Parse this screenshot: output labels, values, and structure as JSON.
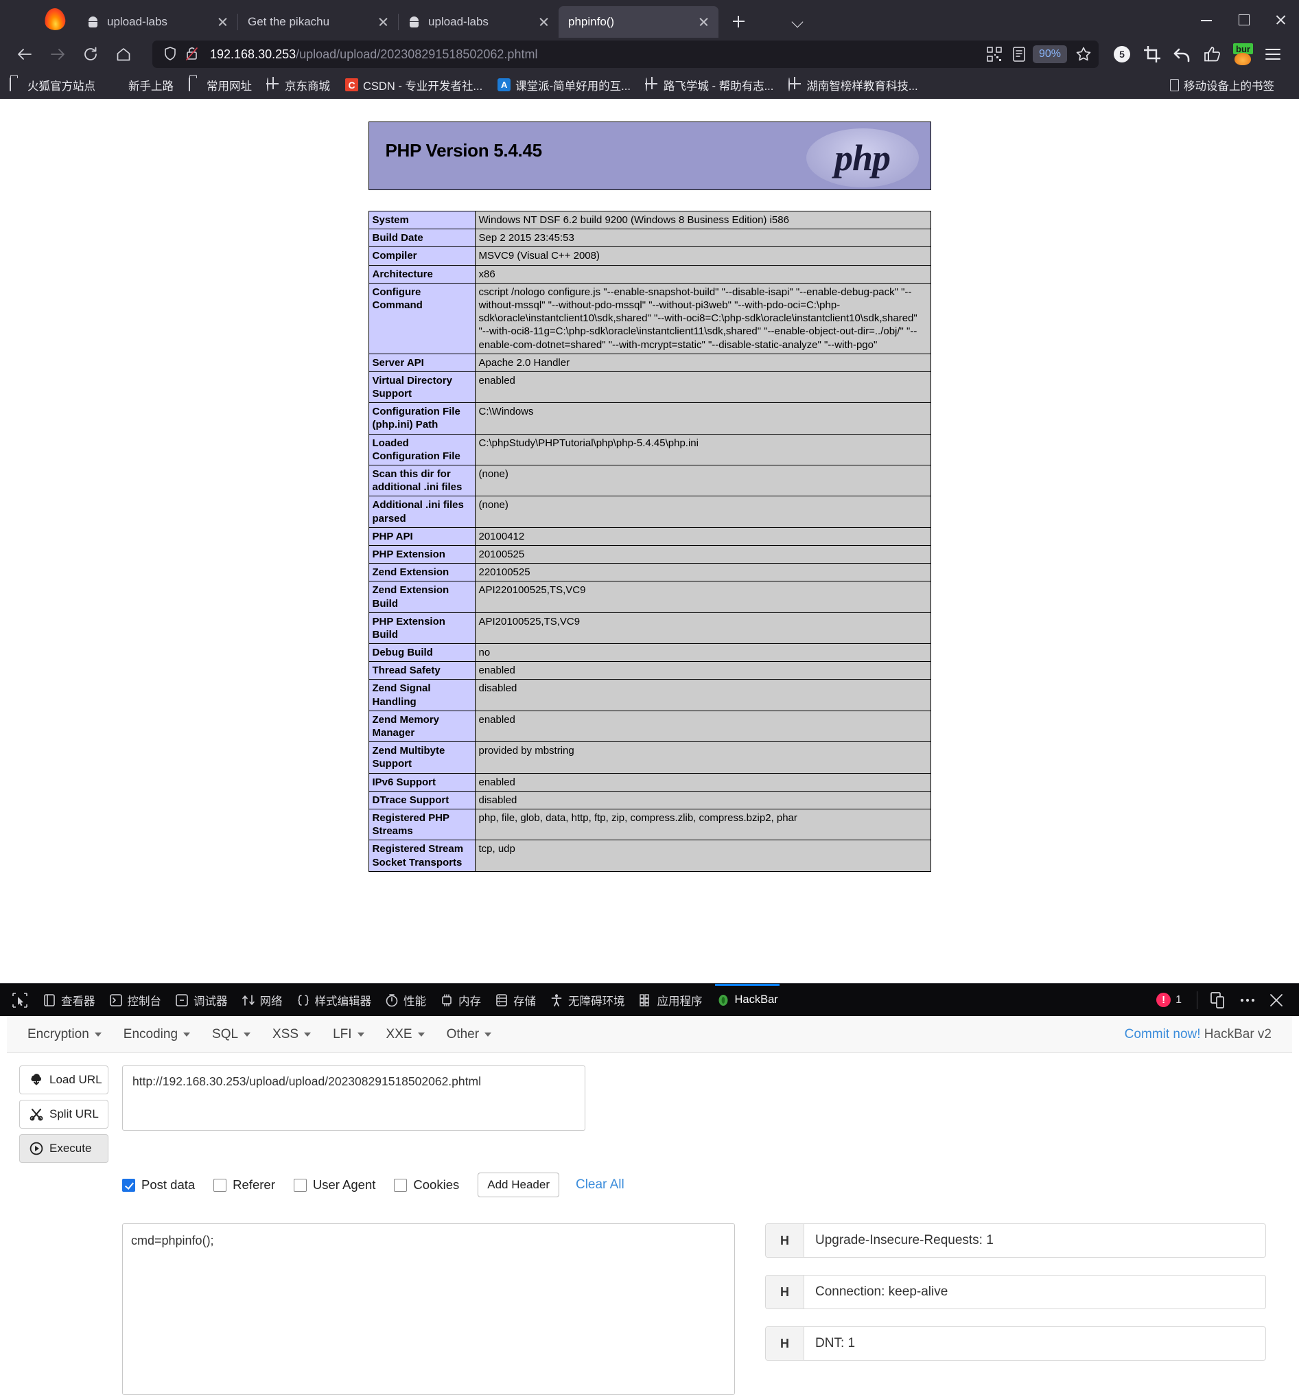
{
  "browser": {
    "tabs": [
      {
        "title": "upload-labs",
        "icon": "android-icon",
        "active": false
      },
      {
        "title": "Get the pikachu",
        "icon": "blank-icon",
        "active": false
      },
      {
        "title": "upload-labs",
        "icon": "android-icon",
        "active": false
      },
      {
        "title": "phpinfo()",
        "icon": "blank-icon",
        "active": true
      }
    ],
    "new_tab_label": "+",
    "list_all_tabs_label": "v",
    "window_controls": {
      "minimize": "–",
      "maximize": "□",
      "close": "×"
    },
    "nav": {
      "back_icon": "back-arrow-icon",
      "forward_icon": "forward-arrow-icon",
      "reload_icon": "reload-icon",
      "home_icon": "home-icon"
    },
    "url": {
      "host": "192.168.30.253",
      "path": "/upload/upload/202308291518502062.phtml",
      "full": "192.168.30.253/upload/upload/202308291518502062.phtml",
      "shield_icon": "shield-icon",
      "lock_icon": "broken-lock-icon",
      "qr_icon": "qr-code-icon",
      "reader_icon": "reader-view-icon",
      "zoom_level": "90%",
      "bookmark_icon": "star-icon"
    },
    "toolbar_right": [
      {
        "name": "adblock-counter-icon",
        "label": "5"
      },
      {
        "name": "screenshot-crop-icon",
        "label": ""
      },
      {
        "name": "undo-arrow-icon",
        "label": ""
      },
      {
        "name": "thumbs-up-icon",
        "label": ""
      },
      {
        "name": "burp-extension-icon",
        "label": "bur"
      },
      {
        "name": "hamburger-menu-icon",
        "label": ""
      }
    ],
    "bookmarks": [
      {
        "label": "火狐官方站点",
        "icon": "folder-icon"
      },
      {
        "label": "新手上路",
        "icon": "firefox-icon"
      },
      {
        "label": "常用网址",
        "icon": "folder-icon"
      },
      {
        "label": "京东商城",
        "icon": "globe-icon"
      },
      {
        "label": "CSDN - 专业开发者社...",
        "icon": "csdn-icon",
        "badge": "C"
      },
      {
        "label": "课堂派-简单好用的互...",
        "icon": "ketangpai-icon",
        "badge": "A"
      },
      {
        "label": "路飞学城 - 帮助有志...",
        "icon": "globe-icon"
      },
      {
        "label": "湖南智榜样教育科技...",
        "icon": "globe-icon"
      }
    ],
    "bookmarks_right": {
      "label": "移动设备上的书签",
      "icon": "mobile-device-icon"
    }
  },
  "phpinfo": {
    "title": "PHP Version 5.4.45",
    "logo_text": "php",
    "rows": [
      {
        "key": "System",
        "value": "Windows NT DSF 6.2 build 9200 (Windows 8 Business Edition) i586"
      },
      {
        "key": "Build Date",
        "value": "Sep 2 2015 23:45:53"
      },
      {
        "key": "Compiler",
        "value": "MSVC9 (Visual C++ 2008)"
      },
      {
        "key": "Architecture",
        "value": "x86"
      },
      {
        "key": "Configure Command",
        "value": "cscript /nologo configure.js \"--enable-snapshot-build\" \"--disable-isapi\" \"--enable-debug-pack\" \"--without-mssql\" \"--without-pdo-mssql\" \"--without-pi3web\" \"--with-pdo-oci=C:\\php-sdk\\oracle\\instantclient10\\sdk,shared\" \"--with-oci8=C:\\php-sdk\\oracle\\instantclient10\\sdk,shared\" \"--with-oci8-11g=C:\\php-sdk\\oracle\\instantclient11\\sdk,shared\" \"--enable-object-out-dir=../obj/\" \"--enable-com-dotnet=shared\" \"--with-mcrypt=static\" \"--disable-static-analyze\" \"--with-pgo\""
      },
      {
        "key": "Server API",
        "value": "Apache 2.0 Handler"
      },
      {
        "key": "Virtual Directory Support",
        "value": "enabled"
      },
      {
        "key": "Configuration File (php.ini) Path",
        "value": "C:\\Windows"
      },
      {
        "key": "Loaded Configuration File",
        "value": "C:\\phpStudy\\PHPTutorial\\php\\php-5.4.45\\php.ini"
      },
      {
        "key": "Scan this dir for additional .ini files",
        "value": "(none)"
      },
      {
        "key": "Additional .ini files parsed",
        "value": "(none)"
      },
      {
        "key": "PHP API",
        "value": "20100412"
      },
      {
        "key": "PHP Extension",
        "value": "20100525"
      },
      {
        "key": "Zend Extension",
        "value": "220100525"
      },
      {
        "key": "Zend Extension Build",
        "value": "API220100525,TS,VC9"
      },
      {
        "key": "PHP Extension Build",
        "value": "API20100525,TS,VC9"
      },
      {
        "key": "Debug Build",
        "value": "no"
      },
      {
        "key": "Thread Safety",
        "value": "enabled"
      },
      {
        "key": "Zend Signal Handling",
        "value": "disabled"
      },
      {
        "key": "Zend Memory Manager",
        "value": "enabled"
      },
      {
        "key": "Zend Multibyte Support",
        "value": "provided by mbstring"
      },
      {
        "key": "IPv6 Support",
        "value": "enabled"
      },
      {
        "key": "DTrace Support",
        "value": "disabled"
      },
      {
        "key": "Registered PHP Streams",
        "value": "php, file, glob, data, http, ftp, zip, compress.zlib, compress.bzip2, phar"
      },
      {
        "key": "Registered Stream Socket Transports",
        "value": "tcp, udp"
      }
    ]
  },
  "devtools": {
    "picker_icon": "element-picker-icon",
    "tabs": [
      {
        "label": "查看器",
        "icon": "inspector-icon",
        "selected": false
      },
      {
        "label": "控制台",
        "icon": "console-icon",
        "selected": false
      },
      {
        "label": "调试器",
        "icon": "debugger-icon",
        "selected": false
      },
      {
        "label": "网络",
        "icon": "network-icon",
        "selected": false
      },
      {
        "label": "样式编辑器",
        "icon": "style-editor-icon",
        "selected": false
      },
      {
        "label": "性能",
        "icon": "performance-icon",
        "selected": false
      },
      {
        "label": "内存",
        "icon": "memory-icon",
        "selected": false
      },
      {
        "label": "存储",
        "icon": "storage-icon",
        "selected": false
      },
      {
        "label": "无障碍环境",
        "icon": "accessibility-icon",
        "selected": false
      },
      {
        "label": "应用程序",
        "icon": "application-icon",
        "selected": false
      },
      {
        "label": "HackBar",
        "icon": "hackbar-icon",
        "selected": true
      }
    ],
    "error_count": "1",
    "responsive_icon": "responsive-design-icon",
    "more_icon": "more-options-icon",
    "close_icon": "close-devtools-icon"
  },
  "hackbar": {
    "menus": [
      "Encryption",
      "Encoding",
      "SQL",
      "XSS",
      "LFI",
      "XXE",
      "Other"
    ],
    "commit_link": "Commit now!",
    "version_label": "HackBar v2",
    "buttons": [
      {
        "label": "Load URL",
        "icon": "load-url-icon"
      },
      {
        "label": "Split URL",
        "icon": "split-url-icon"
      },
      {
        "label": "Execute",
        "icon": "execute-icon"
      }
    ],
    "url_value": "http://192.168.30.253/upload/upload/202308291518502062.phtml",
    "url_placeholder": "",
    "checkboxes": [
      {
        "label": "Post data",
        "checked": true
      },
      {
        "label": "Referer",
        "checked": false
      },
      {
        "label": "User Agent",
        "checked": false
      },
      {
        "label": "Cookies",
        "checked": false
      }
    ],
    "add_header_label": "Add Header",
    "clear_all_label": "Clear All",
    "post_data_value": "cmd=phpinfo();",
    "headers": [
      {
        "key": "H",
        "value": "Upgrade-Insecure-Requests: 1"
      },
      {
        "key": "H",
        "value": "Connection: keep-alive"
      },
      {
        "key": "H",
        "value": "DNT: 1"
      }
    ]
  },
  "colors": {
    "chrome_bg": "#2b2a33",
    "tab_active": "#42414d",
    "urlbar_bg": "#1c1b22",
    "accent_blue": "#0a84ff",
    "php_banner": "#9999cc",
    "php_key_cell": "#ccccff",
    "php_val_cell": "#cccccc",
    "error_red": "#ff2a5f",
    "link_blue": "#3c8ddb"
  }
}
